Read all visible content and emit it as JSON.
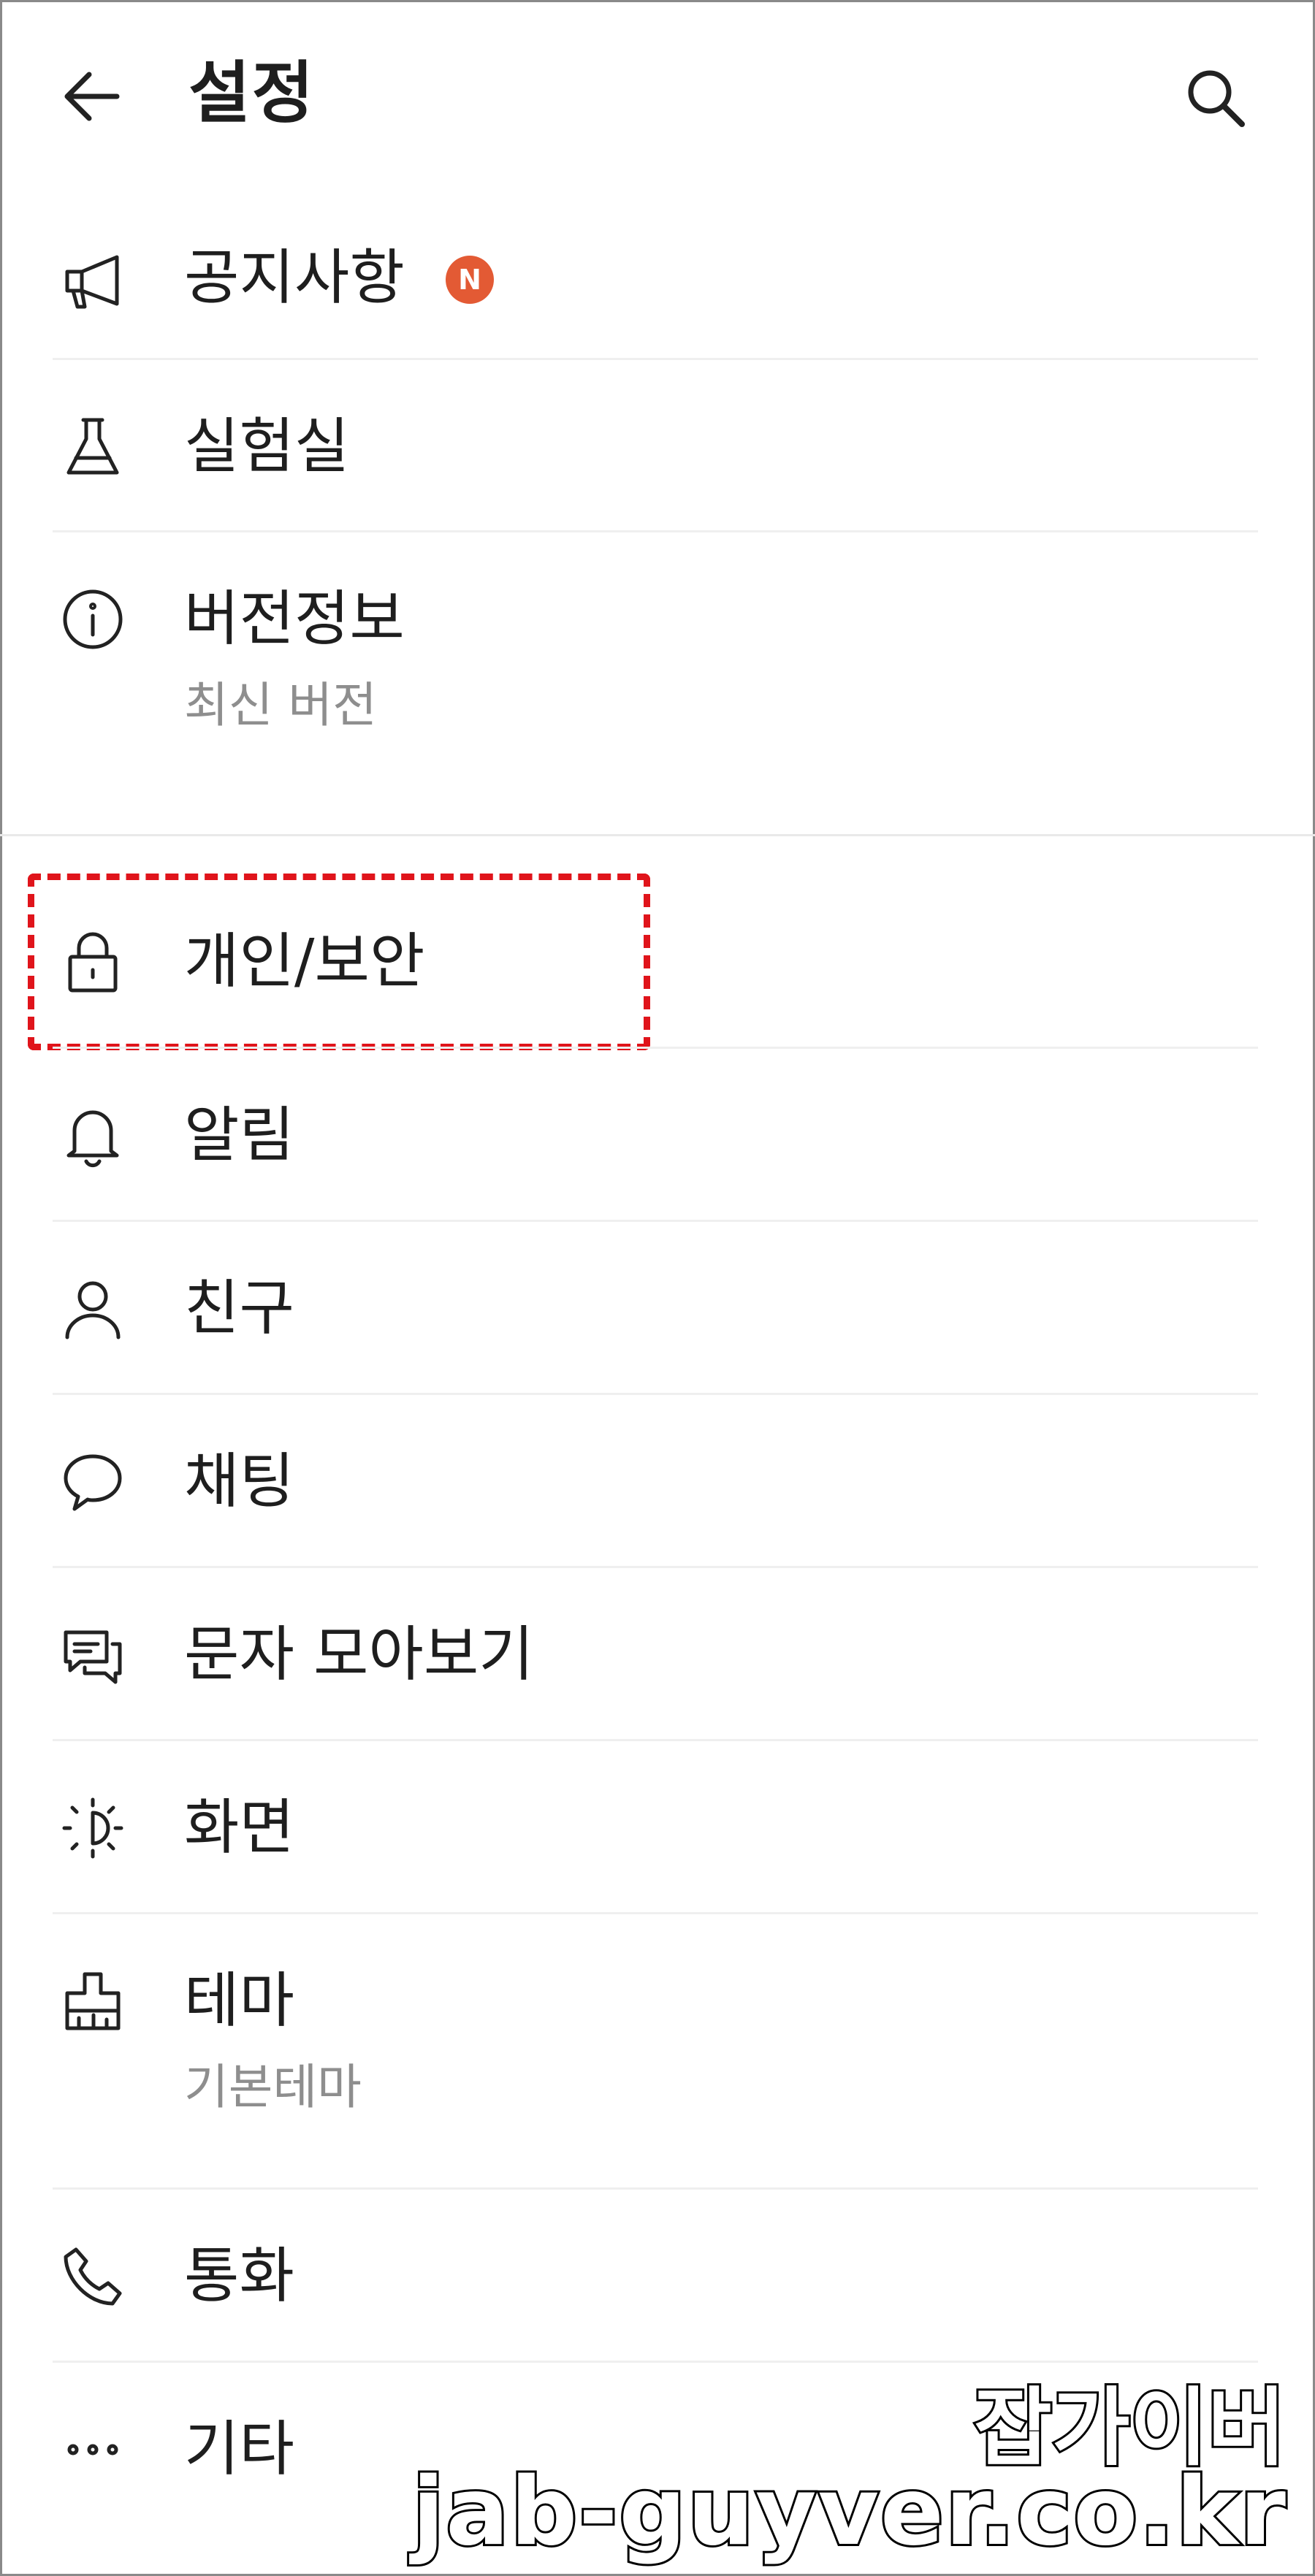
{
  "header": {
    "title": "설정",
    "back_icon": "arrow-left-icon",
    "search_icon": "search-icon"
  },
  "menu": {
    "notice": {
      "label": "공지사항",
      "badge": "N",
      "icon": "megaphone-icon"
    },
    "lab": {
      "label": "실험실",
      "icon": "flask-icon"
    },
    "version": {
      "label": "버전정보",
      "sub": "최신 버전",
      "icon": "info-icon"
    },
    "privacy": {
      "label": "개인/보안",
      "icon": "lock-icon"
    },
    "notifications": {
      "label": "알림",
      "icon": "bell-icon"
    },
    "friends": {
      "label": "친구",
      "icon": "person-icon"
    },
    "chat": {
      "label": "채팅",
      "icon": "speech-bubble-icon"
    },
    "sms": {
      "label": "문자 모아보기",
      "icon": "messages-icon"
    },
    "display": {
      "label": "화면",
      "icon": "brightness-icon"
    },
    "theme": {
      "label": "테마",
      "sub": "기본테마",
      "icon": "paint-brush-icon"
    },
    "call": {
      "label": "통화",
      "icon": "phone-icon"
    },
    "etc": {
      "label": "기타",
      "icon": "more-dots-icon"
    }
  },
  "watermark": {
    "line1": "잡가이버",
    "line2": "jab-guyver.co.kr"
  },
  "colors": {
    "badge": "#e35a34",
    "highlight": "#e0141b",
    "divider": "#efefef",
    "subtext": "#8e8e8e"
  }
}
